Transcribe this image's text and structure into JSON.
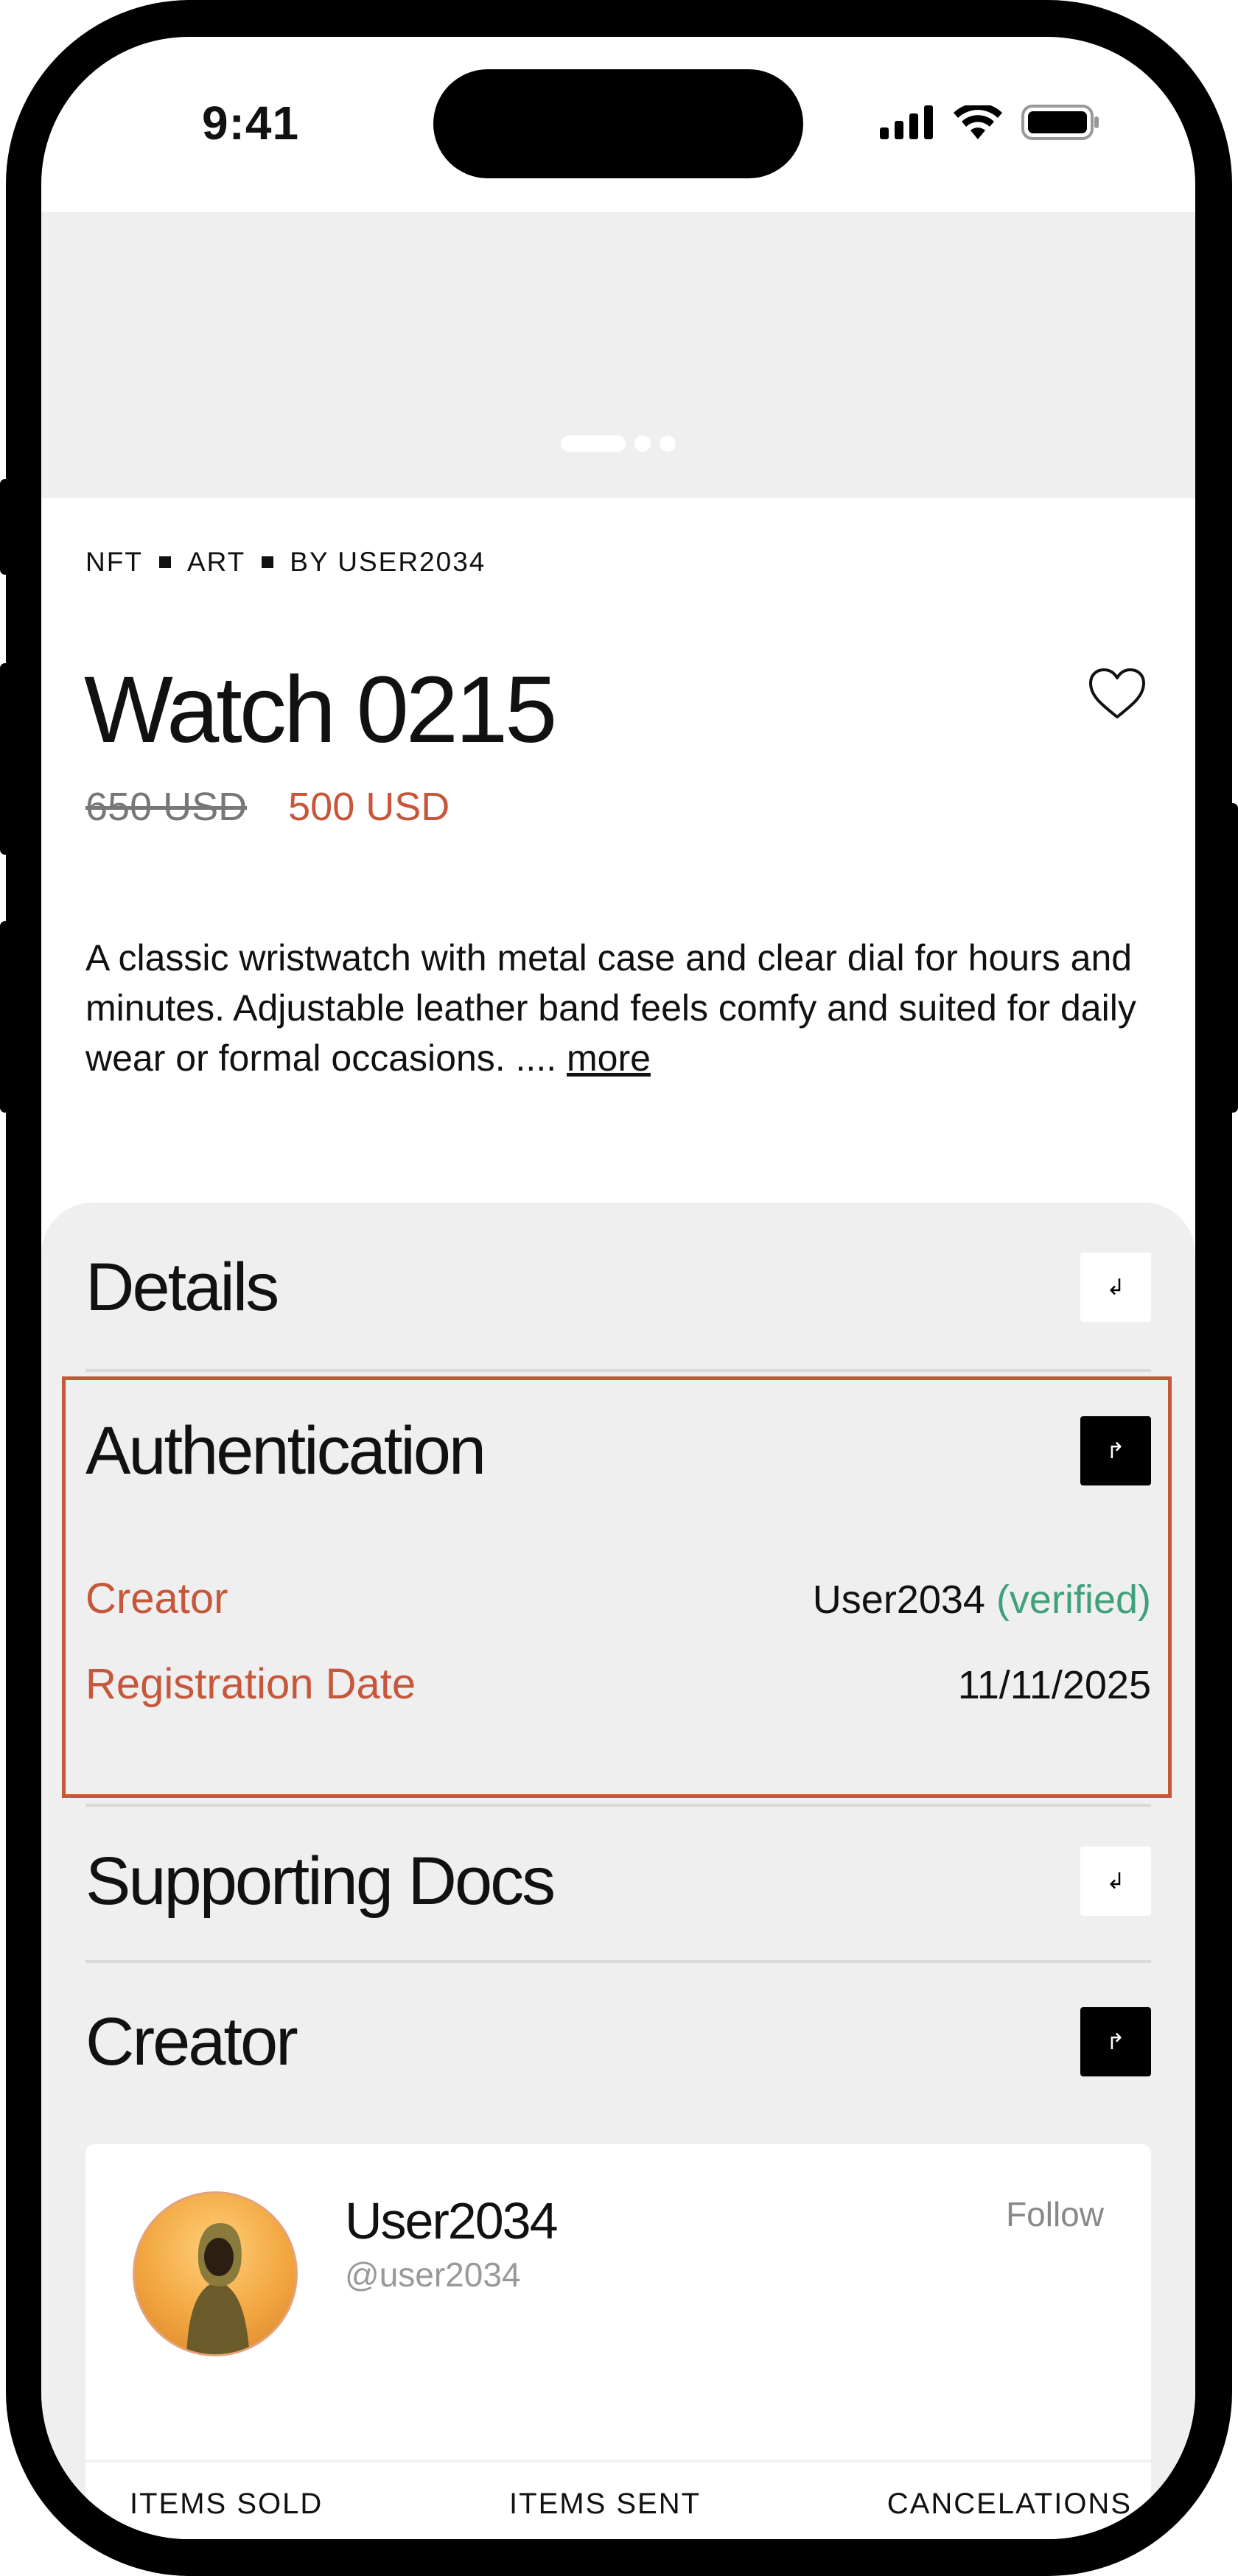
{
  "status_bar": {
    "time": "9:41"
  },
  "hero": {
    "dots": 3,
    "active_dot": 0
  },
  "breadcrumb": {
    "items": [
      "NFT",
      "ART",
      "BY USER2034"
    ]
  },
  "product": {
    "title": "Watch 0215",
    "price_old": "650 USD",
    "price_new": "500 USD",
    "description": "A classic wristwatch with metal case and clear dial for hours and minutes. Adjustable leather band feels comfy and suited for daily wear or formal occasions. ....",
    "more_label": "more"
  },
  "sections": {
    "details": {
      "title": "Details",
      "toggle_icon": "↲"
    },
    "authentication": {
      "title": "Authentication",
      "toggle_icon": "↱",
      "rows": [
        {
          "key": "Creator",
          "value": "User2034",
          "note": "(verified)"
        },
        {
          "key": "Registration Date",
          "value": "11/11/2025"
        }
      ]
    },
    "supporting_docs": {
      "title": "Supporting Docs",
      "toggle_icon": "↲"
    },
    "creator": {
      "title": "Creator",
      "toggle_icon": "↱",
      "name": "User2034",
      "handle": "@user2034",
      "follow_label": "Follow",
      "stats": [
        "ITEMS SOLD",
        "ITEMS SENT",
        "CANCELATIONS"
      ]
    }
  },
  "colors": {
    "accent": "#c6573a",
    "verified": "#3fa07a",
    "panel": "#efefef"
  }
}
